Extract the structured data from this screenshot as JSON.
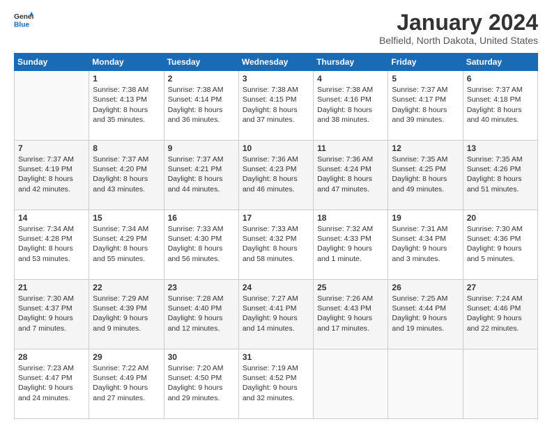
{
  "logo": {
    "general": "General",
    "blue": "Blue"
  },
  "header": {
    "title": "January 2024",
    "subtitle": "Belfield, North Dakota, United States"
  },
  "weekdays": [
    "Sunday",
    "Monday",
    "Tuesday",
    "Wednesday",
    "Thursday",
    "Friday",
    "Saturday"
  ],
  "weeks": [
    [
      {
        "day": "",
        "sunrise": "",
        "sunset": "",
        "daylight": ""
      },
      {
        "day": "1",
        "sunrise": "Sunrise: 7:38 AM",
        "sunset": "Sunset: 4:13 PM",
        "daylight": "Daylight: 8 hours and 35 minutes."
      },
      {
        "day": "2",
        "sunrise": "Sunrise: 7:38 AM",
        "sunset": "Sunset: 4:14 PM",
        "daylight": "Daylight: 8 hours and 36 minutes."
      },
      {
        "day": "3",
        "sunrise": "Sunrise: 7:38 AM",
        "sunset": "Sunset: 4:15 PM",
        "daylight": "Daylight: 8 hours and 37 minutes."
      },
      {
        "day": "4",
        "sunrise": "Sunrise: 7:38 AM",
        "sunset": "Sunset: 4:16 PM",
        "daylight": "Daylight: 8 hours and 38 minutes."
      },
      {
        "day": "5",
        "sunrise": "Sunrise: 7:37 AM",
        "sunset": "Sunset: 4:17 PM",
        "daylight": "Daylight: 8 hours and 39 minutes."
      },
      {
        "day": "6",
        "sunrise": "Sunrise: 7:37 AM",
        "sunset": "Sunset: 4:18 PM",
        "daylight": "Daylight: 8 hours and 40 minutes."
      }
    ],
    [
      {
        "day": "7",
        "sunrise": "Sunrise: 7:37 AM",
        "sunset": "Sunset: 4:19 PM",
        "daylight": "Daylight: 8 hours and 42 minutes."
      },
      {
        "day": "8",
        "sunrise": "Sunrise: 7:37 AM",
        "sunset": "Sunset: 4:20 PM",
        "daylight": "Daylight: 8 hours and 43 minutes."
      },
      {
        "day": "9",
        "sunrise": "Sunrise: 7:37 AM",
        "sunset": "Sunset: 4:21 PM",
        "daylight": "Daylight: 8 hours and 44 minutes."
      },
      {
        "day": "10",
        "sunrise": "Sunrise: 7:36 AM",
        "sunset": "Sunset: 4:23 PM",
        "daylight": "Daylight: 8 hours and 46 minutes."
      },
      {
        "day": "11",
        "sunrise": "Sunrise: 7:36 AM",
        "sunset": "Sunset: 4:24 PM",
        "daylight": "Daylight: 8 hours and 47 minutes."
      },
      {
        "day": "12",
        "sunrise": "Sunrise: 7:35 AM",
        "sunset": "Sunset: 4:25 PM",
        "daylight": "Daylight: 8 hours and 49 minutes."
      },
      {
        "day": "13",
        "sunrise": "Sunrise: 7:35 AM",
        "sunset": "Sunset: 4:26 PM",
        "daylight": "Daylight: 8 hours and 51 minutes."
      }
    ],
    [
      {
        "day": "14",
        "sunrise": "Sunrise: 7:34 AM",
        "sunset": "Sunset: 4:28 PM",
        "daylight": "Daylight: 8 hours and 53 minutes."
      },
      {
        "day": "15",
        "sunrise": "Sunrise: 7:34 AM",
        "sunset": "Sunset: 4:29 PM",
        "daylight": "Daylight: 8 hours and 55 minutes."
      },
      {
        "day": "16",
        "sunrise": "Sunrise: 7:33 AM",
        "sunset": "Sunset: 4:30 PM",
        "daylight": "Daylight: 8 hours and 56 minutes."
      },
      {
        "day": "17",
        "sunrise": "Sunrise: 7:33 AM",
        "sunset": "Sunset: 4:32 PM",
        "daylight": "Daylight: 8 hours and 58 minutes."
      },
      {
        "day": "18",
        "sunrise": "Sunrise: 7:32 AM",
        "sunset": "Sunset: 4:33 PM",
        "daylight": "Daylight: 9 hours and 1 minute."
      },
      {
        "day": "19",
        "sunrise": "Sunrise: 7:31 AM",
        "sunset": "Sunset: 4:34 PM",
        "daylight": "Daylight: 9 hours and 3 minutes."
      },
      {
        "day": "20",
        "sunrise": "Sunrise: 7:30 AM",
        "sunset": "Sunset: 4:36 PM",
        "daylight": "Daylight: 9 hours and 5 minutes."
      }
    ],
    [
      {
        "day": "21",
        "sunrise": "Sunrise: 7:30 AM",
        "sunset": "Sunset: 4:37 PM",
        "daylight": "Daylight: 9 hours and 7 minutes."
      },
      {
        "day": "22",
        "sunrise": "Sunrise: 7:29 AM",
        "sunset": "Sunset: 4:39 PM",
        "daylight": "Daylight: 9 hours and 9 minutes."
      },
      {
        "day": "23",
        "sunrise": "Sunrise: 7:28 AM",
        "sunset": "Sunset: 4:40 PM",
        "daylight": "Daylight: 9 hours and 12 minutes."
      },
      {
        "day": "24",
        "sunrise": "Sunrise: 7:27 AM",
        "sunset": "Sunset: 4:41 PM",
        "daylight": "Daylight: 9 hours and 14 minutes."
      },
      {
        "day": "25",
        "sunrise": "Sunrise: 7:26 AM",
        "sunset": "Sunset: 4:43 PM",
        "daylight": "Daylight: 9 hours and 17 minutes."
      },
      {
        "day": "26",
        "sunrise": "Sunrise: 7:25 AM",
        "sunset": "Sunset: 4:44 PM",
        "daylight": "Daylight: 9 hours and 19 minutes."
      },
      {
        "day": "27",
        "sunrise": "Sunrise: 7:24 AM",
        "sunset": "Sunset: 4:46 PM",
        "daylight": "Daylight: 9 hours and 22 minutes."
      }
    ],
    [
      {
        "day": "28",
        "sunrise": "Sunrise: 7:23 AM",
        "sunset": "Sunset: 4:47 PM",
        "daylight": "Daylight: 9 hours and 24 minutes."
      },
      {
        "day": "29",
        "sunrise": "Sunrise: 7:22 AM",
        "sunset": "Sunset: 4:49 PM",
        "daylight": "Daylight: 9 hours and 27 minutes."
      },
      {
        "day": "30",
        "sunrise": "Sunrise: 7:20 AM",
        "sunset": "Sunset: 4:50 PM",
        "daylight": "Daylight: 9 hours and 29 minutes."
      },
      {
        "day": "31",
        "sunrise": "Sunrise: 7:19 AM",
        "sunset": "Sunset: 4:52 PM",
        "daylight": "Daylight: 9 hours and 32 minutes."
      },
      {
        "day": "",
        "sunrise": "",
        "sunset": "",
        "daylight": ""
      },
      {
        "day": "",
        "sunrise": "",
        "sunset": "",
        "daylight": ""
      },
      {
        "day": "",
        "sunrise": "",
        "sunset": "",
        "daylight": ""
      }
    ]
  ]
}
